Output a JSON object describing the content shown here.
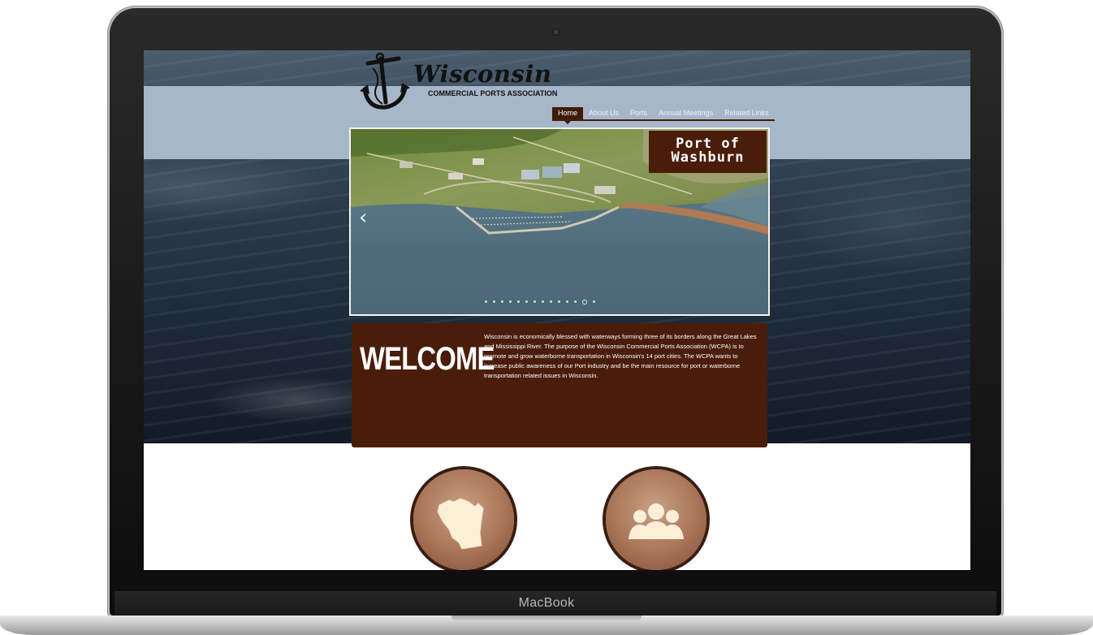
{
  "device": {
    "brand": "MacBook"
  },
  "site": {
    "logo_title": "Wisconsin",
    "logo_subtitle": "COMMERCIAL PORTS ASSOCIATION"
  },
  "nav": {
    "items": [
      {
        "label": "Home",
        "active": true
      },
      {
        "label": "About Us",
        "active": false
      },
      {
        "label": "Ports",
        "active": false
      },
      {
        "label": "Annual Meetings",
        "active": false
      },
      {
        "label": "Related Links",
        "active": false
      }
    ]
  },
  "slideshow": {
    "caption_line1": "Port of",
    "caption_line2": "Washburn",
    "prev_icon": "chevron-left-icon",
    "dot_count": 14,
    "active_dot": 12
  },
  "welcome": {
    "title": "WELCOME",
    "text": "Wisconsin is economically blessed with waterways forming three of its borders along the Great Lakes and Mississippi River. The purpose of the Wisconsin Commercial Ports Association (WCPA) is to promote and grow waterborne transportation in Wisconsin's 14 port cities. The WCPA wants to increase public awareness of our Port industry and be the main resource for port or waterborne transportation related issues in Wisconsin."
  },
  "icons": [
    {
      "name": "wisconsin-map-icon"
    },
    {
      "name": "group-people-icon"
    }
  ],
  "colors": {
    "brand_brown": "#4a1d0b",
    "header_band": "#a6b7c9"
  }
}
